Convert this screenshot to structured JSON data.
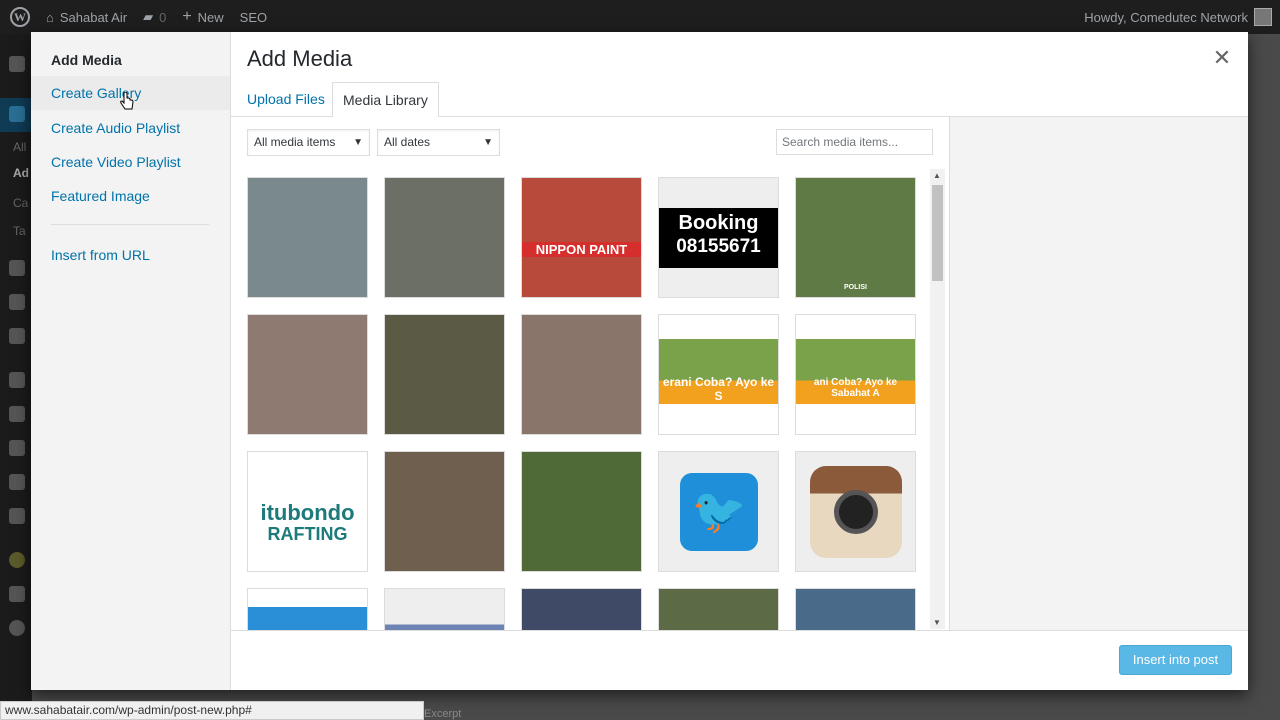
{
  "adminbar": {
    "site_name": "Sahabat Air",
    "comments_count": "0",
    "new_label": "New",
    "seo_label": "SEO",
    "howdy": "Howdy, Comedutec Network"
  },
  "adminmenu": {
    "partial_labels": [
      "All",
      "Ad",
      "Ca",
      "Ta"
    ]
  },
  "modal": {
    "title": "Add Media",
    "menu": {
      "title": "Add Media",
      "items": [
        "Create Gallery",
        "Create Audio Playlist",
        "Create Video Playlist",
        "Featured Image"
      ],
      "insert_from_url": "Insert from URL"
    },
    "tabs": [
      "Upload Files",
      "Media Library"
    ],
    "active_tab": "Media Library",
    "filters": {
      "type": "All media items",
      "date": "All dates"
    },
    "search_placeholder": "Search media items...",
    "insert_button": "Insert into post"
  },
  "media": {
    "thumb_texts": {
      "booking_line1": "Booking",
      "booking_line2": "08155671",
      "nippon": "NIPPON PAINT",
      "banner1": "erani Coba? Ayo ke S",
      "banner2": "ani Coba? Ayo ke Sabahat A",
      "situbondo_line1": "itubondo",
      "situbondo_line2": "RAFTING",
      "polisi": "POLISI"
    },
    "items": [
      {
        "label": "waterfall-rafting",
        "color": "#7a8a8c"
      },
      {
        "label": "river-rafting-rocks",
        "color": "#6b6f66"
      },
      {
        "label": "nippon-paint-group",
        "color": "#b84a3c"
      },
      {
        "label": "booking-banner",
        "color": "#000000"
      },
      {
        "label": "outdoor-group-games",
        "color": "#5f7a44"
      },
      {
        "label": "group-red-uniform-1",
        "color": "#8e7a70"
      },
      {
        "label": "forest-team-game",
        "color": "#5b5a44"
      },
      {
        "label": "group-red-uniform-2",
        "color": "#8a756a"
      },
      {
        "label": "rafting-banner-1",
        "color": "#f2a11f"
      },
      {
        "label": "rafting-banner-2",
        "color": "#f2a11f"
      },
      {
        "label": "situbondo-rafting-logo",
        "color": "#ffffff"
      },
      {
        "label": "rafting-crowd",
        "color": "#6f5f4e"
      },
      {
        "label": "man-fruit-tree",
        "color": "#4f6a36"
      },
      {
        "label": "twitter-logo",
        "color": "#1e8fd8"
      },
      {
        "label": "instagram-logo",
        "color": "#b38a60"
      },
      {
        "label": "partial-blue-logo",
        "color": "#2b8fd8"
      },
      {
        "label": "facebook-logo",
        "color": "#3b5998"
      },
      {
        "label": "rafting-group-helmets",
        "color": "#3e4a66"
      },
      {
        "label": "river-scene",
        "color": "#5d6a46"
      },
      {
        "label": "rafters-cheering",
        "color": "#4a6a8a"
      }
    ]
  },
  "statusbar": {
    "url": "www.sahabatair.com/wp-admin/post-new.php#",
    "below": "Excerpt"
  }
}
